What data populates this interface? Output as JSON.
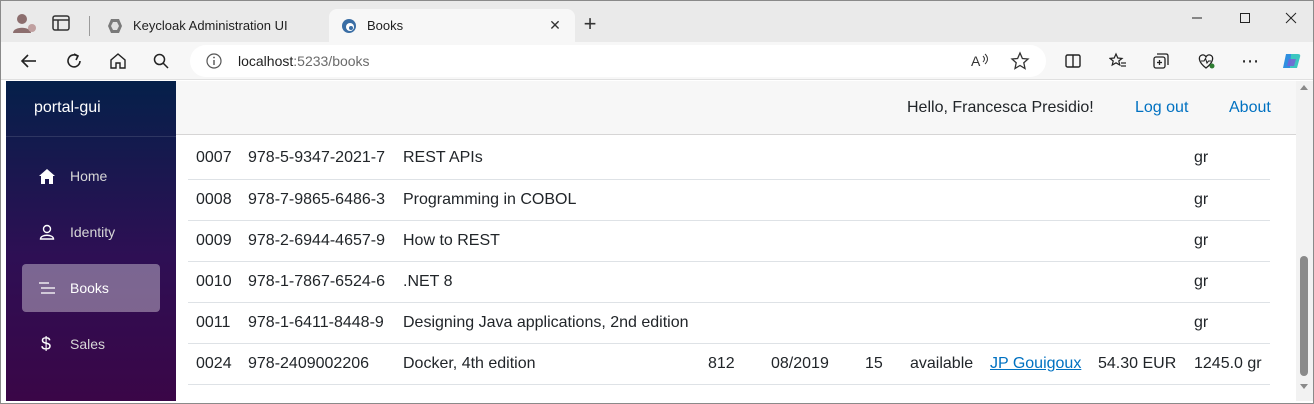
{
  "browser": {
    "tabs": [
      {
        "title": "Keycloak Administration UI",
        "favicon": "keycloak-icon",
        "active": false
      },
      {
        "title": "Books",
        "favicon": "edge-page-icon",
        "active": true
      }
    ],
    "new_tab_label": "+",
    "close_label": "✕",
    "window_controls": {
      "minimize": "—",
      "maximize": "☐",
      "close": "✕"
    },
    "address": {
      "host": "localhost",
      "rest": ":5233/books"
    },
    "more_label": "⋯"
  },
  "app": {
    "brand": "portal-gui",
    "nav": [
      {
        "label": "Home",
        "icon": "home-icon",
        "active": false
      },
      {
        "label": "Identity",
        "icon": "person-icon",
        "active": false
      },
      {
        "label": "Books",
        "icon": "list-icon",
        "active": true
      },
      {
        "label": "Sales",
        "icon": "dollar-icon",
        "active": false
      }
    ],
    "topbar": {
      "greeting": "Hello, Francesca Presidio!",
      "logout": "Log out",
      "about": "About"
    }
  },
  "books": {
    "rows": [
      {
        "id": "0007",
        "isbn": "978-5-9347-2021-7",
        "title": "REST APIs",
        "pages": "",
        "date": "",
        "qty": "",
        "status": "",
        "author": "",
        "price": "",
        "weight": "gr"
      },
      {
        "id": "0008",
        "isbn": "978-7-9865-6486-3",
        "title": "Programming in COBOL",
        "pages": "",
        "date": "",
        "qty": "",
        "status": "",
        "author": "",
        "price": "",
        "weight": "gr"
      },
      {
        "id": "0009",
        "isbn": "978-2-6944-4657-9",
        "title": "How to REST",
        "pages": "",
        "date": "",
        "qty": "",
        "status": "",
        "author": "",
        "price": "",
        "weight": "gr"
      },
      {
        "id": "0010",
        "isbn": "978-1-7867-6524-6",
        "title": ".NET 8",
        "pages": "",
        "date": "",
        "qty": "",
        "status": "",
        "author": "",
        "price": "",
        "weight": "gr"
      },
      {
        "id": "0011",
        "isbn": "978-1-6411-8448-9",
        "title": "Designing Java applications, 2nd edition",
        "pages": "",
        "date": "",
        "qty": "",
        "status": "",
        "author": "",
        "price": "",
        "weight": "gr"
      },
      {
        "id": "0024",
        "isbn": "978-2409002206",
        "title": "Docker, 4th edition",
        "pages": "812",
        "date": "08/2019",
        "qty": "15",
        "status": "available",
        "author": "JP Gouigoux",
        "price": "54.30 EUR",
        "weight": "1245.0 gr"
      }
    ]
  },
  "colors": {
    "sidebar_top": "#05204a",
    "sidebar_bottom": "#3a0647",
    "link": "#0071c1",
    "text": "#212529"
  }
}
